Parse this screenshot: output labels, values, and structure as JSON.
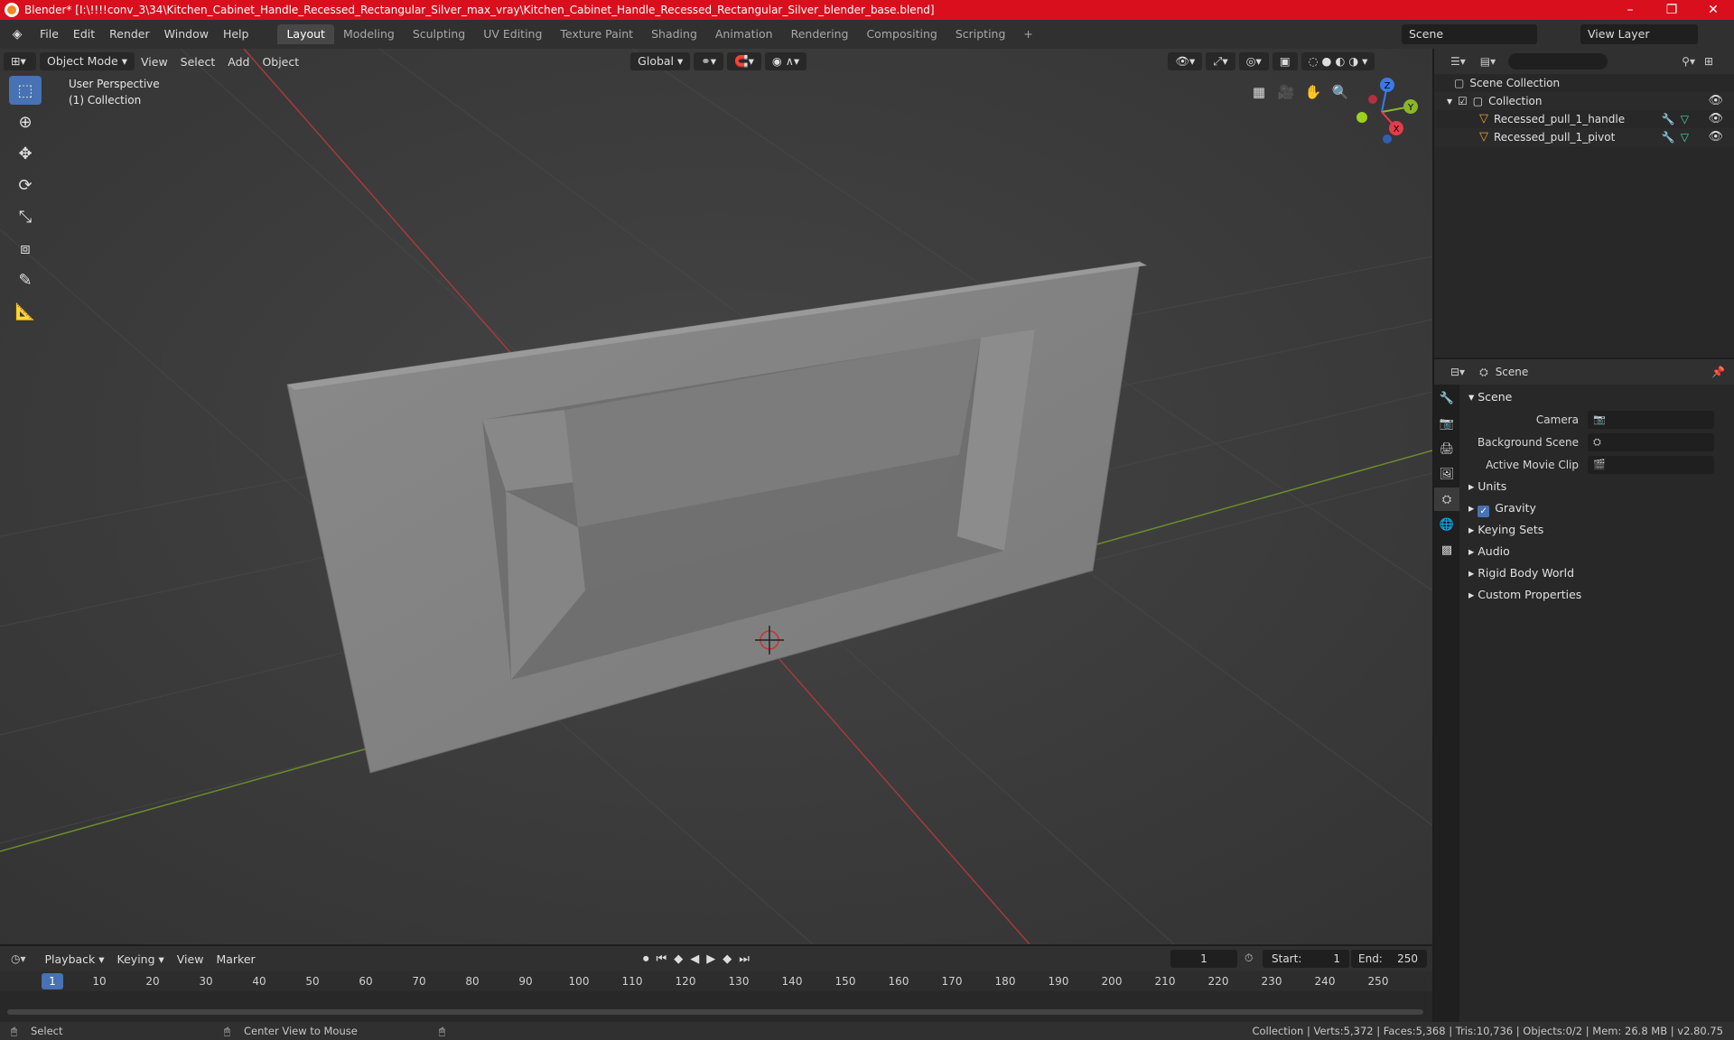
{
  "window": {
    "title": "Blender* [I:\\!!!!conv_3\\34\\Kitchen_Cabinet_Handle_Recessed_Rectangular_Silver_max_vray\\Kitchen_Cabinet_Handle_Recessed_Rectangular_Silver_blender_base.blend]",
    "minimize": "–",
    "maximize": "❐",
    "close": "✕"
  },
  "menubar": {
    "items": [
      "File",
      "Edit",
      "Render",
      "Window",
      "Help"
    ]
  },
  "workspaces": {
    "tabs": [
      "Layout",
      "Modeling",
      "Sculpting",
      "UV Editing",
      "Texture Paint",
      "Shading",
      "Animation",
      "Rendering",
      "Compositing",
      "Scripting"
    ],
    "active": "Layout",
    "add": "+"
  },
  "scene_selector": {
    "value": "Scene"
  },
  "view_layer": {
    "value": "View Layer"
  },
  "viewport": {
    "mode": "Object Mode",
    "menus": [
      "View",
      "Select",
      "Add",
      "Object"
    ],
    "transform_orientation": "Global",
    "perspective_label": "User Perspective",
    "collection_label": "(1) Collection",
    "gizmo": {
      "z": "Z",
      "y": "Y",
      "x": "X"
    }
  },
  "outliner": {
    "search_placeholder": "",
    "rows": [
      {
        "label": "Scene Collection"
      },
      {
        "label": "Collection"
      },
      {
        "label": "Recessed_pull_1_handle"
      },
      {
        "label": "Recessed_pull_1_pivot"
      }
    ]
  },
  "properties": {
    "header": "Scene",
    "section": "Scene",
    "fields": [
      {
        "label": "Camera"
      },
      {
        "label": "Background Scene"
      },
      {
        "label": "Active Movie Clip"
      }
    ],
    "subpanels": [
      "Units",
      "Gravity",
      "Keying Sets",
      "Audio",
      "Rigid Body World",
      "Custom Properties"
    ],
    "gravity_checked": true
  },
  "timeline": {
    "menus": [
      "Playback",
      "Keying",
      "View",
      "Marker"
    ],
    "current_frame": "1",
    "start_label": "Start:",
    "start_value": "1",
    "end_label": "End:",
    "end_value": "250",
    "ticks": [
      "1",
      "10",
      "20",
      "30",
      "40",
      "50",
      "60",
      "70",
      "80",
      "90",
      "100",
      "110",
      "120",
      "130",
      "140",
      "150",
      "160",
      "170",
      "180",
      "190",
      "200",
      "210",
      "220",
      "230",
      "240",
      "250"
    ]
  },
  "statusbar": {
    "select": "Select",
    "center_view": "Center View to Mouse",
    "stats": "Collection | Verts:5,372 | Faces:5,368 | Tris:10,736 | Objects:0/2 | Mem: 26.8 MB | v2.80.75"
  },
  "colors": {
    "title_bar": "#d90f1d",
    "accent": "#4772b3",
    "object_icon": "#f09e3a"
  }
}
